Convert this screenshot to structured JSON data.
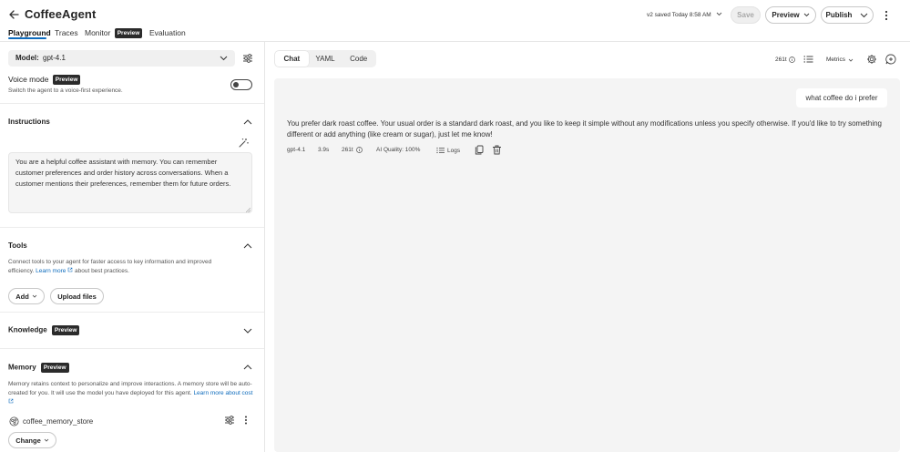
{
  "header": {
    "title": "CoffeeAgent",
    "tabs": [
      {
        "label": "Playground"
      },
      {
        "label": "Traces"
      },
      {
        "label": "Monitor",
        "badge": "Preview"
      },
      {
        "label": "Evaluation"
      }
    ],
    "saved_status": "v2 saved Today 8:58 AM",
    "save_label": "Save",
    "preview_label": "Preview",
    "publish_label": "Publish"
  },
  "left": {
    "model_label": "Model:",
    "model_value": "gpt-4.1",
    "voice_mode": {
      "title": "Voice mode",
      "badge": "Preview",
      "description": "Switch the agent to a voice-first experience."
    },
    "instructions": {
      "title": "Instructions",
      "text": "You are a helpful coffee assistant with memory. You can remember customer preferences and order history across conversations. When a customer mentions their preferences, remember them for future orders."
    },
    "tools": {
      "title": "Tools",
      "description_start": "Connect tools to your agent for faster access to key information and improved efficiency.",
      "learn_more": "Learn more",
      "description_end": "about best practices.",
      "add_label": "Add",
      "upload_label": "Upload files"
    },
    "knowledge": {
      "title": "Knowledge",
      "badge": "Preview"
    },
    "memory": {
      "title": "Memory",
      "badge": "Preview",
      "description": "Memory retains context to personalize and improve interactions. A memory store will be auto-created for you. It will use the model you have deployed for this agent.",
      "learn_more": "Learn more about cost",
      "store_name": "coffee_memory_store",
      "change_label": "Change"
    }
  },
  "right": {
    "view_tabs": [
      {
        "label": "Chat"
      },
      {
        "label": "YAML"
      },
      {
        "label": "Code"
      }
    ],
    "token_count": "261t",
    "metrics_label": "Metrics",
    "user_message": "what coffee do i prefer",
    "assistant_message": "You prefer dark roast coffee. Your usual order is a standard dark roast, and you like to keep it simple without any modifications unless you specify otherwise. If you'd like to try something different or add anything (like cream or sugar), just let me know!",
    "meta": {
      "model": "gpt-4.1",
      "latency": "3.9s",
      "tokens": "261t",
      "quality": "AI Quality: 100%",
      "logs": "Logs"
    }
  }
}
